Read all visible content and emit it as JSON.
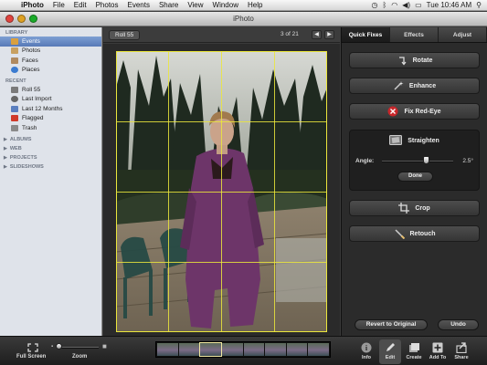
{
  "menubar": {
    "app_name": "iPhoto",
    "menus": [
      "File",
      "Edit",
      "Photos",
      "Events",
      "Share",
      "View",
      "Window",
      "Help"
    ],
    "clock": "Tue 10:46 AM"
  },
  "window": {
    "title": "iPhoto"
  },
  "sidebar": {
    "library_header": "LIBRARY",
    "library_items": [
      {
        "label": "Events",
        "icon": "events-icon",
        "color": "#d9a040",
        "selected": true
      },
      {
        "label": "Photos",
        "icon": "photos-icon",
        "color": "#c8a060",
        "selected": false
      },
      {
        "label": "Faces",
        "icon": "faces-icon",
        "color": "#b08a60",
        "selected": false
      },
      {
        "label": "Places",
        "icon": "places-icon",
        "color": "#3b7bd0",
        "selected": false
      }
    ],
    "recent_header": "RECENT",
    "recent_items": [
      {
        "label": "Roll 55",
        "icon": "roll-icon",
        "color": "#7a7a7a"
      },
      {
        "label": "Last Import",
        "icon": "import-icon",
        "color": "#666"
      },
      {
        "label": "Last 12 Months",
        "icon": "calendar-icon",
        "color": "#5b7fbf"
      },
      {
        "label": "Flagged",
        "icon": "flag-icon",
        "color": "#d03a2a"
      },
      {
        "label": "Trash",
        "icon": "trash-icon",
        "color": "#8a8a8a"
      }
    ],
    "collapsed_sections": [
      "ALBUMS",
      "WEB",
      "PROJECTS",
      "SLIDESHOWS"
    ]
  },
  "viewer": {
    "roll_button": "Roll 55",
    "counter": "3 of 21",
    "prev_icon": "arrow-left-icon",
    "next_icon": "arrow-right-icon"
  },
  "panel": {
    "tabs": [
      {
        "label": "Quick Fixes",
        "active": true
      },
      {
        "label": "Effects",
        "active": false
      },
      {
        "label": "Adjust",
        "active": false
      }
    ],
    "fixes": {
      "rotate": "Rotate",
      "enhance": "Enhance",
      "fix_red_eye": "Fix Red-Eye",
      "straighten": "Straighten",
      "crop": "Crop",
      "retouch": "Retouch"
    },
    "straighten": {
      "angle_label": "Angle:",
      "angle_value": "2.5°",
      "done": "Done",
      "slider_fraction": 0.62
    },
    "revert": "Revert to Original",
    "undo": "Undo"
  },
  "bottombar": {
    "full_screen": "Full Screen",
    "zoom": "Zoom",
    "zoom_fraction": 0.0,
    "tools": [
      {
        "label": "Info",
        "icon": "info-icon",
        "active": false
      },
      {
        "label": "Edit",
        "icon": "edit-icon",
        "active": true
      },
      {
        "label": "Create",
        "icon": "create-icon",
        "active": false
      },
      {
        "label": "Add To",
        "icon": "add-to-icon",
        "active": false
      },
      {
        "label": "Share",
        "icon": "share-icon",
        "active": false
      }
    ],
    "selected_thumbnail": 2
  },
  "colors": {
    "accent_selection": "#5f80bb",
    "grid_lines": "#ebe63c",
    "robe": "#6d3569"
  }
}
